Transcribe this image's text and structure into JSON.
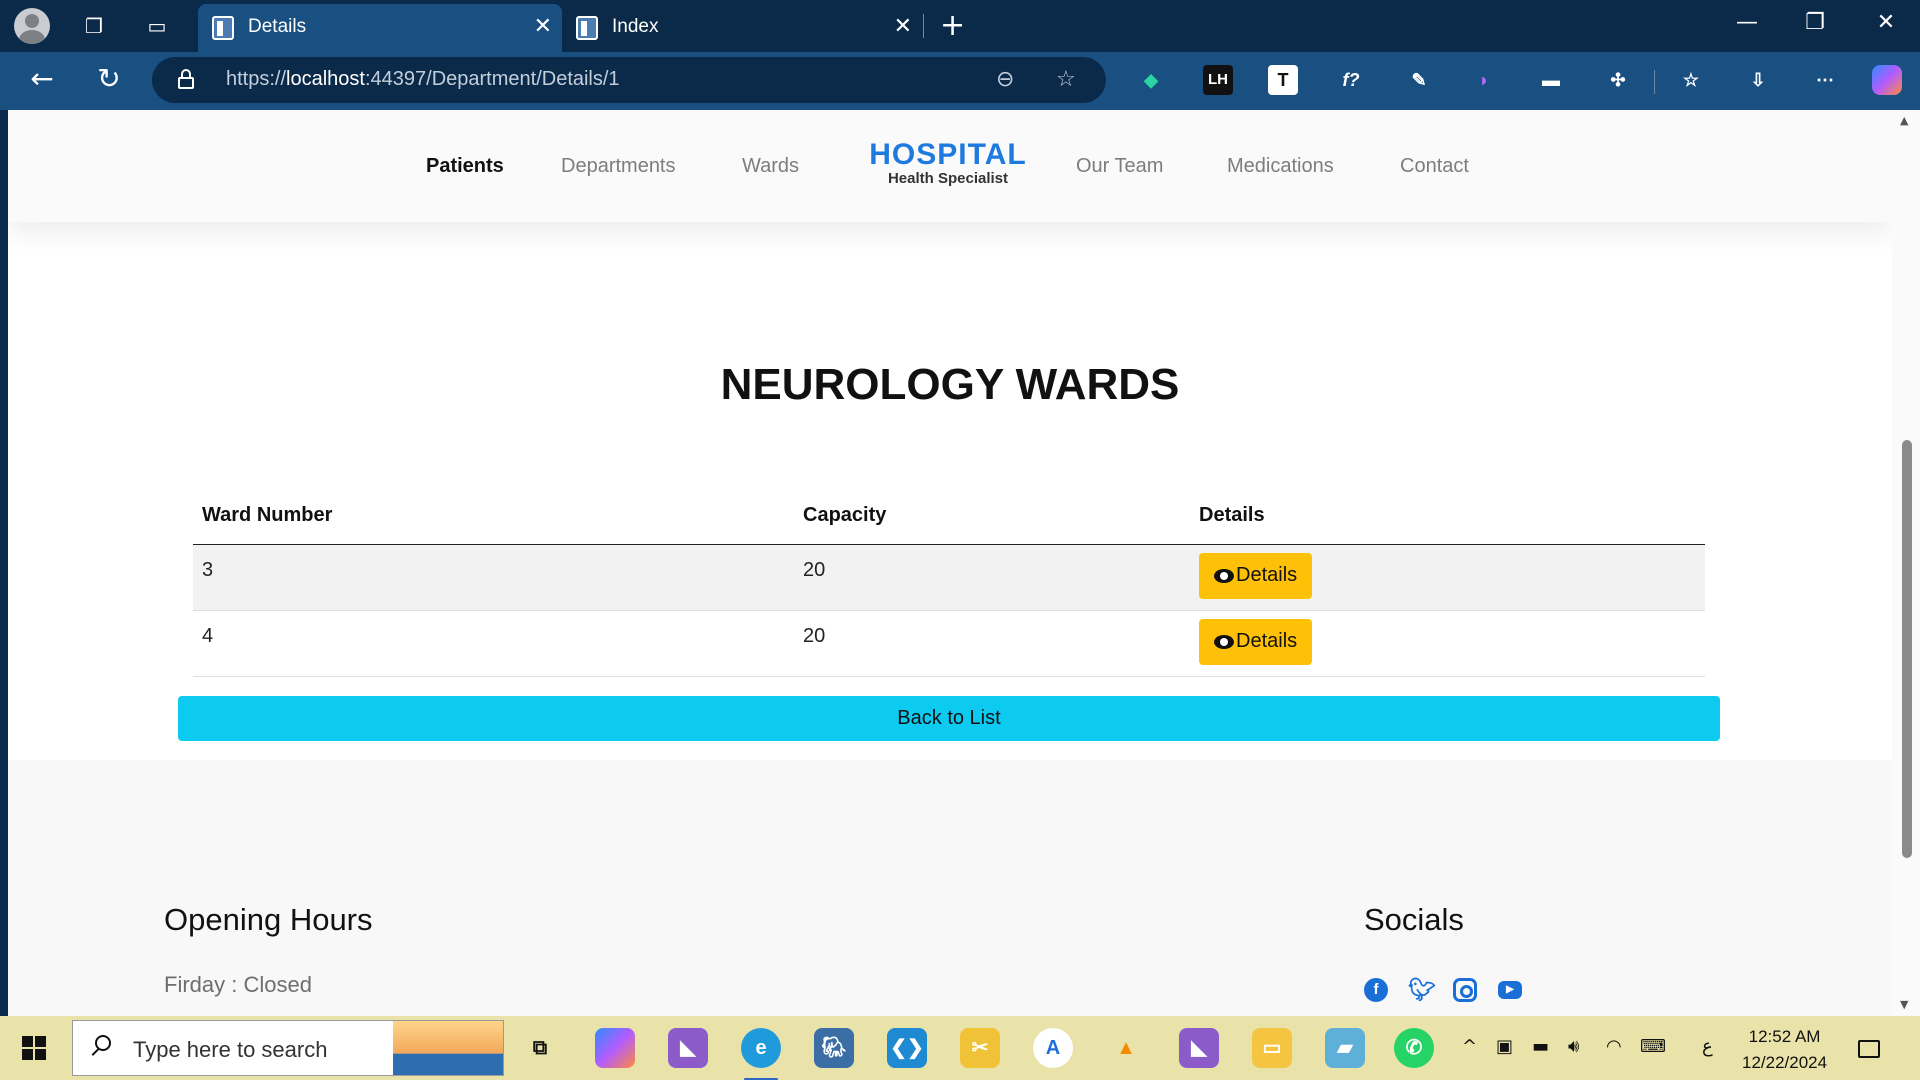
{
  "browser": {
    "tabs": [
      {
        "label": "Details",
        "active": true
      },
      {
        "label": "Index",
        "active": false
      }
    ],
    "url_prefix": "https://",
    "url_host": "localhost",
    "url_rest": ":44397/Department/Details/1"
  },
  "site": {
    "nav": [
      "Patients",
      "Departments",
      "Wards"
    ],
    "nav_right": [
      "Our Team",
      "Medications",
      "Contact"
    ],
    "brand_title": "HOSPITAL",
    "brand_subtitle": "Health Specialist"
  },
  "main": {
    "title": "NEUROLOGY WARDS",
    "table": {
      "headers": [
        "Ward Number",
        "Capacity",
        "Details"
      ],
      "rows": [
        {
          "ward_number": "3",
          "capacity": "20",
          "action": "Details"
        },
        {
          "ward_number": "4",
          "capacity": "20",
          "action": "Details"
        }
      ]
    },
    "back_label": "Back to List"
  },
  "footer": {
    "opening_title": "Opening Hours",
    "opening_text": "Firday : Closed",
    "socials_title": "Socials",
    "socials": [
      "facebook-icon",
      "twitter-icon",
      "instagram-icon",
      "youtube-icon"
    ]
  },
  "taskbar": {
    "search_placeholder": "Type here to search",
    "time": "12:52 AM",
    "date": "12/22/2024",
    "lang": "ع"
  },
  "colors": {
    "brand": "#1f7ae0",
    "details_button": "#ffc107",
    "back_button": "#0dcaf0",
    "taskbar": "#e9e3a9"
  }
}
